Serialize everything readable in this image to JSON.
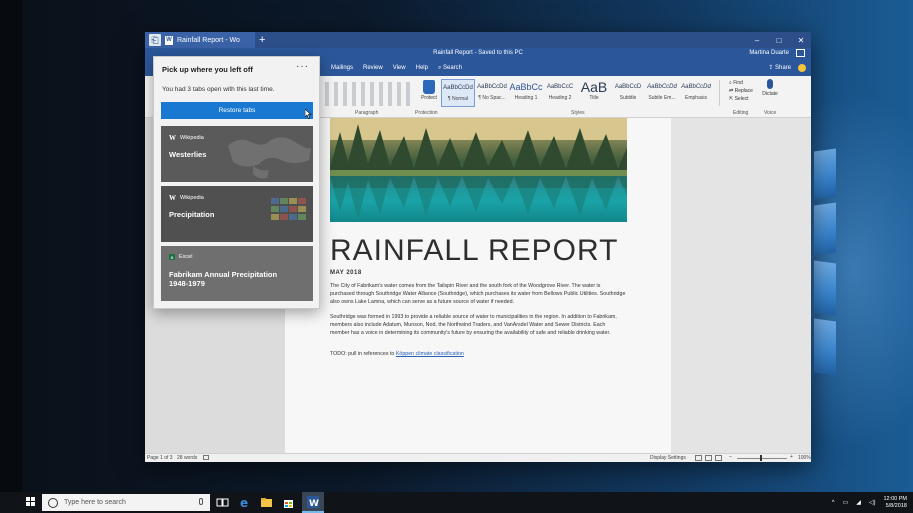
{
  "window": {
    "tab_label": "Rainfall Report - Wo",
    "doc_status": "Rainfall Report - Saved to this PC",
    "user_name": "Martina Duarte",
    "controls": {
      "minimize": "–",
      "maximize": "□",
      "close": "✕"
    }
  },
  "ribbon": {
    "menu_tabs": [
      "Mailings",
      "Review",
      "View",
      "Help"
    ],
    "search_label": "Search",
    "share_label": "Share",
    "protect_label": "Protect",
    "styles": [
      {
        "sample": "AaBbCcDd",
        "name": "¶ Normal",
        "kind": "normal"
      },
      {
        "sample": "AaBbCcDd",
        "name": "¶ No Spac...",
        "kind": "normal"
      },
      {
        "sample": "AaBbCc",
        "name": "Heading 1",
        "kind": "mid"
      },
      {
        "sample": "AaBbCcC",
        "name": "Heading 2",
        "kind": "normal"
      },
      {
        "sample": "AaB",
        "name": "Title",
        "kind": "big"
      },
      {
        "sample": "AaBbCcD",
        "name": "Subtitle",
        "kind": "normal"
      },
      {
        "sample": "AaBbCcDd",
        "name": "Subtle Em...",
        "kind": "ital"
      },
      {
        "sample": "AaBbCcDd",
        "name": "Emphasis",
        "kind": "ital"
      }
    ],
    "editing": {
      "find": "Find",
      "replace": "Replace",
      "select": "Select"
    },
    "dictate_label": "Dictate",
    "group_labels": {
      "paragraph": "Paragraph",
      "protection": "Protection",
      "styles": "Styles",
      "editing": "Editing",
      "voice": "Voice"
    }
  },
  "document": {
    "title": "RAINFALL REPORT",
    "date": "MAY 2018",
    "para1": "The City of Fabrikam's water comes from the Tailspin River and the south fork of the Woodgrove River. The water is purchased through Southridge Water Alliance (Southridge), which purchases its water from Bellows Public Utilities. Southridge also owns Lake Lamna, which can serve as a future source of water if needed.",
    "para2": "Southridge was formed in 1993 to provide a reliable source of water to municipalities in the region. In addition to Fabrikam, members also include Adatum, Munson, Nod, the Northwind Traders, and VanArsdel Water and Sewer Districts. Each member has a voice in determining its community's future by ensuring the availability of safe and reliable drinking water.",
    "todo_prefix": "TODO: pull in references to ",
    "todo_link": "Köppen climate classification"
  },
  "statusbar": {
    "pages": "Page 1 of 3",
    "words": "28 words",
    "display_settings": "Display Settings",
    "zoom": "100%"
  },
  "flyout": {
    "title": "Pick up where you left off",
    "more": "···",
    "description": "You had 3 tabs open with this last time.",
    "restore_label": "Restore tabs",
    "cards": [
      {
        "source": "Wikipedia",
        "title": "Westerlies",
        "icon": "wikipedia-icon"
      },
      {
        "source": "Wikipedia",
        "title": "Precipitation",
        "icon": "wikipedia-icon"
      },
      {
        "source": "Excel",
        "title": "Fabrikam Annual Precipitation 1948-1979",
        "icon": "excel-icon"
      }
    ]
  },
  "taskbar": {
    "search_placeholder": "Type here to search",
    "time": "12:00 PM",
    "date": "5/8/2018"
  },
  "colors": {
    "word_blue": "#2b579a",
    "restore_button": "#1979d2",
    "accent_link": "#2a62b5"
  }
}
